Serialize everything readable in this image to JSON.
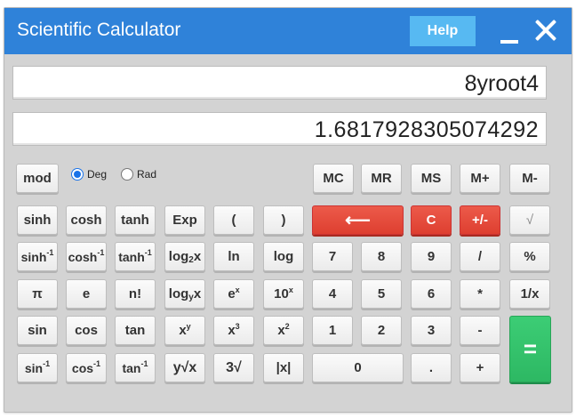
{
  "window": {
    "title": "Scientific Calculator",
    "help_label": "Help"
  },
  "display": {
    "expression": "8yroot4",
    "result": "1.6817928305074292"
  },
  "angle_mode": {
    "deg_label": "Deg",
    "rad_label": "Rad",
    "selected": "Deg"
  },
  "keys": {
    "mod": "mod",
    "mc": "MC",
    "mr": "MR",
    "ms": "MS",
    "mplus": "M+",
    "mminus": "M-",
    "sinh": "sinh",
    "cosh": "cosh",
    "tanh": "tanh",
    "exp": "Exp",
    "lparen": "(",
    "rparen": ")",
    "backspace": "⟵",
    "clear": "C",
    "negate": "+/-",
    "sqrt": "√",
    "asinh_base": "sinh",
    "acosh_base": "cosh",
    "atanh_base": "tanh",
    "inv_exp": "-1",
    "log2_base": "log",
    "log2_sub": "2",
    "log2_var": "x",
    "ln": "ln",
    "log": "log",
    "d7": "7",
    "d8": "8",
    "d9": "9",
    "div": "/",
    "percent": "%",
    "pi": "π",
    "e": "e",
    "fact": "n!",
    "logy_base": "log",
    "logy_sub": "y",
    "logy_var": "x",
    "ex_base": "e",
    "ex_sup": "x",
    "tenx_base": "10",
    "tenx_sup": "x",
    "d4": "4",
    "d5": "5",
    "d6": "6",
    "mul": "*",
    "recip": "1/x",
    "sin": "sin",
    "cos": "cos",
    "tan": "tan",
    "xy_base": "x",
    "xy_sup": "y",
    "x3_base": "x",
    "x3_sup": "3",
    "x2_base": "x",
    "x2_sup": "2",
    "d1": "1",
    "d2": "2",
    "d3": "3",
    "sub": "-",
    "equals": "=",
    "asin_base": "sin",
    "acos_base": "cos",
    "atan_base": "tan",
    "yroot": "y√x",
    "cbrt": "3√",
    "abs": "|x|",
    "d0": "0",
    "dot": ".",
    "add": "+"
  },
  "colors": {
    "titlebar": "#2f82d9",
    "help": "#57b9f2",
    "danger": "#de3f30",
    "equals": "#2db863"
  }
}
